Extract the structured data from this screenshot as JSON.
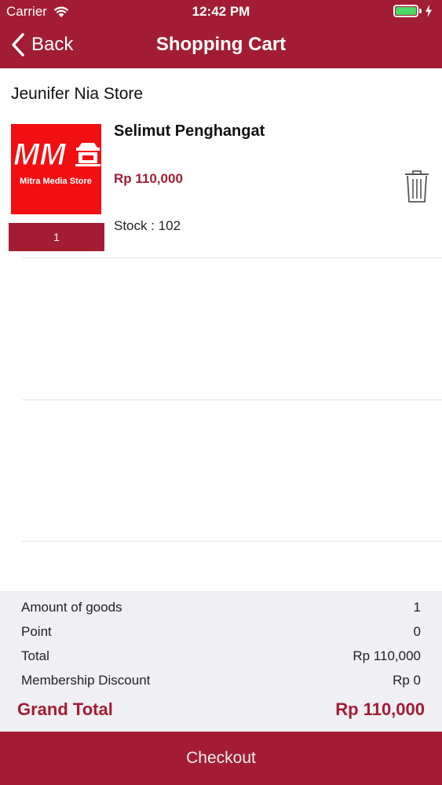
{
  "status_bar": {
    "carrier": "Carrier",
    "time": "12:42 PM",
    "battery_color": "#4cd964"
  },
  "nav": {
    "back_label": "Back",
    "title": "Shopping Cart",
    "bar_color": "#a21d33"
  },
  "store": {
    "name": "Jeunifer Nia Store"
  },
  "item": {
    "name": "Selimut Penghangat",
    "price": "Rp 110,000",
    "stock": "Stock : 102",
    "quantity": "1",
    "image_logo_text": "MM",
    "image_caption": "Mitra Media Store"
  },
  "summary": {
    "rows": [
      {
        "label": "Amount of goods",
        "value": "1"
      },
      {
        "label": "Point",
        "value": "0"
      },
      {
        "label": "Total",
        "value": "Rp 110,000"
      },
      {
        "label": "Membership Discount",
        "value": "Rp 0"
      }
    ],
    "grand_total_label": "Grand Total",
    "grand_total_value": "Rp 110,000"
  },
  "checkout_label": "Checkout",
  "icons": {
    "back": "chevron-left-icon",
    "delete": "trash-icon",
    "wifi": "wifi-icon",
    "battery": "battery-icon"
  }
}
